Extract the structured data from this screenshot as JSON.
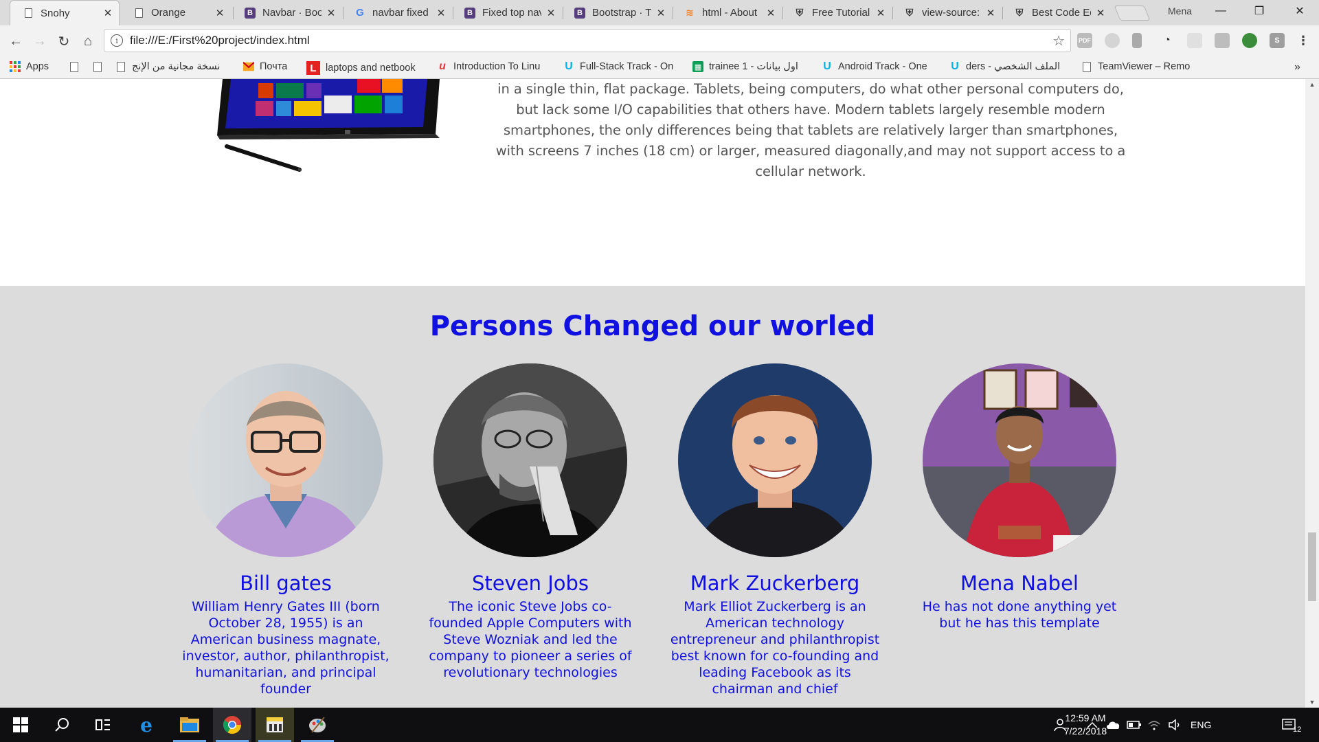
{
  "browser": {
    "tabs": [
      {
        "title": "Snohy",
        "favicon": "page-icon",
        "active": true
      },
      {
        "title": "Orange",
        "favicon": "page-icon",
        "active": false
      },
      {
        "title": "Navbar · Boo",
        "favicon": "bootstrap-icon",
        "active": false
      },
      {
        "title": "navbar fixed",
        "favicon": "google-icon",
        "active": false
      },
      {
        "title": "Fixed top nav",
        "favicon": "bootstrap-icon",
        "active": false
      },
      {
        "title": "Bootstrap · Th",
        "favicon": "bootstrap-icon",
        "active": false
      },
      {
        "title": "html - About",
        "favicon": "stackoverflow-icon",
        "active": false
      },
      {
        "title": "Free Tutorial",
        "favicon": "shield-icon",
        "active": false
      },
      {
        "title": "view-source:",
        "favicon": "shield-icon",
        "active": false
      },
      {
        "title": "Best Code Ed",
        "favicon": "shield-icon",
        "active": false
      }
    ],
    "profile_name": "Mena",
    "url": "file:///E:/First%20project/index.html",
    "bookmarks": [
      {
        "label": "Apps",
        "icon": "apps-grid-icon"
      },
      {
        "label": "",
        "icon": "document-icon"
      },
      {
        "label": "",
        "icon": "document-icon"
      },
      {
        "label": "نسخة مجانية من الإنج",
        "icon": "document-icon"
      },
      {
        "label": "Почта",
        "icon": "mail-icon"
      },
      {
        "label": "laptops and netbook",
        "icon": "l-logo-icon"
      },
      {
        "label": "Introduction To Linu",
        "icon": "udacity-red-icon"
      },
      {
        "label": "Full-Stack Track - On",
        "icon": "udacity-icon"
      },
      {
        "label": "trainee 1 - اول بيانات",
        "icon": "sheets-icon"
      },
      {
        "label": "Android Track - One",
        "icon": "udacity-icon"
      },
      {
        "label": "الملف الشخصي - ders",
        "icon": "udacity-icon"
      },
      {
        "label": "TeamViewer – Remo",
        "icon": "document-icon"
      }
    ],
    "more_bookmarks": "»"
  },
  "page": {
    "article_text": "in a single thin, flat package. Tablets, being computers, do what other personal computers do, but lack some I/O capabilities that others have. Modern tablets largely resemble modern smartphones, the only differences being that tablets are relatively larger than smartphones, with screens 7 inches (18 cm) or larger, measured diagonally,and may not support access to a cellular network.",
    "section_title": "Persons Changed our worled",
    "persons": [
      {
        "name": "Bill gates",
        "bio": "William Henry Gates III (born October 28, 1955) is an American business magnate, investor, author, philanthropist, humanitarian, and principal founder"
      },
      {
        "name": "Steven Jobs",
        "bio": "The iconic Steve Jobs co-founded Apple Computers with Steve Wozniak and led the company to pioneer a series of revolutionary technologies"
      },
      {
        "name": "Mark Zuckerberg",
        "bio": "Mark Elliot Zuckerberg is an American technology entrepreneur and philanthropist best known for co-founding and leading Facebook as its chairman and chief"
      },
      {
        "name": "Mena Nabel",
        "bio": "He has not done anything yet but he has this template"
      }
    ],
    "accent_color": "#1010e0"
  },
  "taskbar": {
    "language": "ENG",
    "time": "12:59 AM",
    "date": "7/22/2018",
    "notification_count": "12"
  }
}
